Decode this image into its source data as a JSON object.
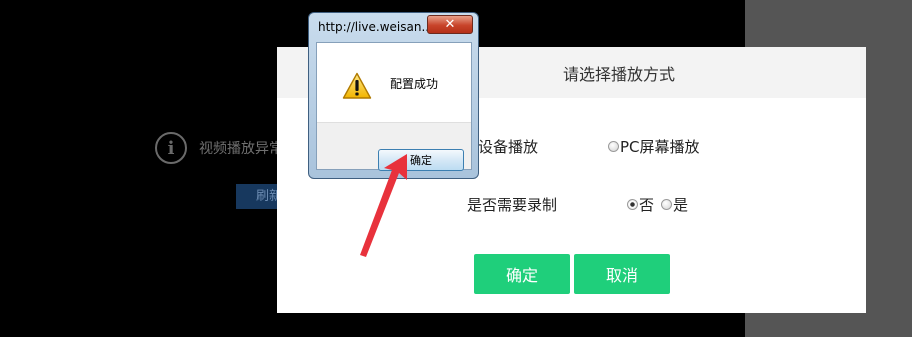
{
  "background": {
    "error_text": "视频播放异常",
    "refresh_label": "刷新"
  },
  "dialog": {
    "title": "请选择播放方式",
    "play_label": "设备播放",
    "play_options": [
      "PC屏幕播放"
    ],
    "record_label": "是否需要录制",
    "record_options": [
      "否",
      "是"
    ],
    "record_selected": "否",
    "confirm_label": "确定",
    "cancel_label": "取消",
    "accent_color": "#1fcf7b"
  },
  "msgbox": {
    "title": "http://live.weisan...",
    "close_glyph": "✕",
    "message": "配置成功",
    "ok_label": "确定",
    "icon": "warning-icon"
  },
  "annotation": {
    "color": "#e8323c"
  }
}
